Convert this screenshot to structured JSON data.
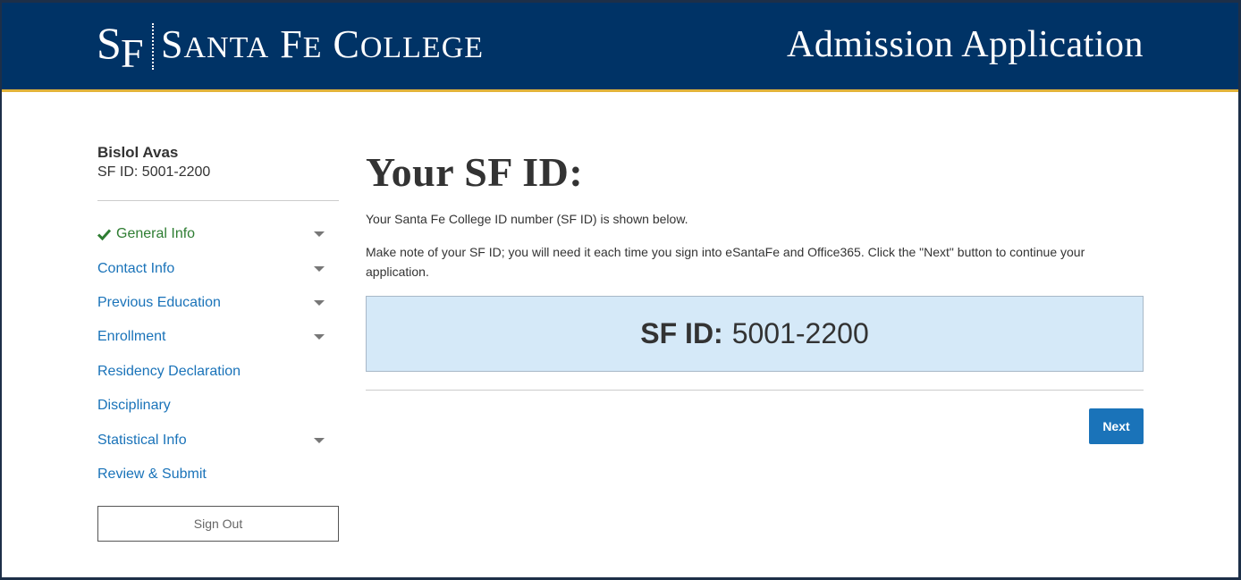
{
  "header": {
    "logo_mark_s": "S",
    "logo_mark_f": "F",
    "logo_name": "Santa Fe College",
    "title": "Admission Application"
  },
  "sidebar": {
    "user_name": "Bislol Avas",
    "user_id_label": "SF ID:",
    "user_id_value": "5001-2200",
    "items": [
      {
        "label": "General Info",
        "completed": true,
        "expandable": true,
        "icon": "check-icon"
      },
      {
        "label": "Contact Info",
        "completed": false,
        "expandable": true
      },
      {
        "label": "Previous Education",
        "completed": false,
        "expandable": true
      },
      {
        "label": "Enrollment",
        "completed": false,
        "expandable": true
      },
      {
        "label": "Residency Declaration",
        "completed": false,
        "expandable": false
      },
      {
        "label": "Disciplinary",
        "completed": false,
        "expandable": false
      },
      {
        "label": "Statistical Info",
        "completed": false,
        "expandable": true
      },
      {
        "label": "Review & Submit",
        "completed": false,
        "expandable": false
      }
    ],
    "sign_out_label": "Sign Out"
  },
  "main": {
    "title": "Your SF ID:",
    "intro": "Your Santa Fe College ID number (SF ID) is shown below.",
    "instructions": "Make note of your SF ID; you will need it each time you sign into eSantaFe and Office365. Click the \"Next\" button to continue your application.",
    "id_label": "SF ID:",
    "id_value": "5001-2200",
    "next_label": "Next"
  },
  "colors": {
    "header_bg": "#003366",
    "header_accent": "#e2b33a",
    "link": "#1a73b9",
    "complete": "#2e7d32",
    "id_box_bg": "#d5e9f8",
    "button_bg": "#1a73b9"
  }
}
